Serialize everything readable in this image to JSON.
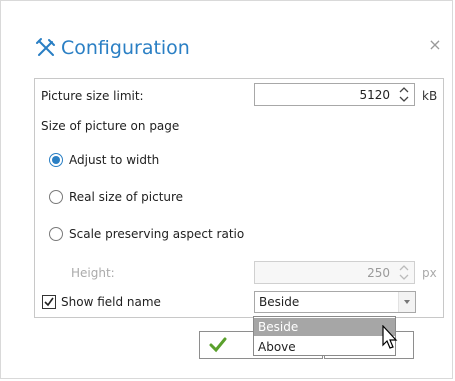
{
  "dialog": {
    "title": "Configuration",
    "title_icon": "tools-icon",
    "close_icon": "close-icon",
    "close_glyph": "×",
    "accent_color": "#2a7fc4"
  },
  "picture_size_limit": {
    "label": "Picture size limit:",
    "value": "5120",
    "unit": "kB"
  },
  "size_on_page": {
    "label": "Size of picture on page",
    "options": [
      {
        "label": "Adjust to width",
        "checked": true
      },
      {
        "label": "Real size of picture",
        "checked": false
      },
      {
        "label": "Scale preserving aspect ratio",
        "checked": false
      }
    ]
  },
  "height": {
    "label": "Height:",
    "value": "250",
    "unit": "px",
    "disabled": true
  },
  "show_field_name": {
    "label": "Show field name",
    "checked": true,
    "position_value": "Beside",
    "dropdown_options": [
      "Beside",
      "Above"
    ],
    "highlighted_option": "Beside"
  },
  "footer": {
    "ok_icon": "checkmark-icon"
  }
}
